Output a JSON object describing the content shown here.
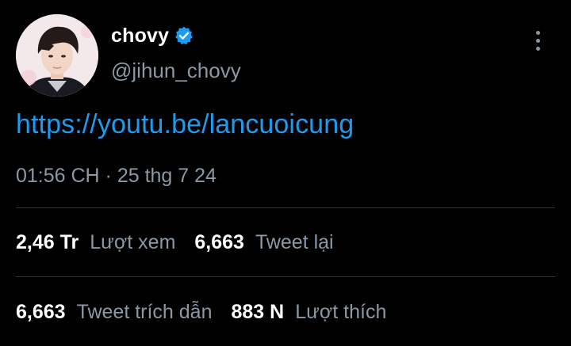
{
  "user": {
    "display_name": "chovy",
    "handle": "@jihun_chovy",
    "verified": true
  },
  "tweet": {
    "link_text": "https://youtu.be/lancuoicung",
    "timestamp": "01:56 CH · 25 thg 7 24"
  },
  "stats": {
    "views_value": "2,46 Tr",
    "views_label": "Lượt xem",
    "retweets_value": "6,663",
    "retweets_label": "Tweet lại",
    "quotes_value": "6,663",
    "quotes_label": "Tweet trích dẫn",
    "likes_value": "883 N",
    "likes_label": "Lượt thích"
  },
  "icons": {
    "verified": "verified-badge-icon",
    "more": "more-vertical-icon"
  },
  "colors": {
    "background": "#000000",
    "link": "#1d9bf0",
    "secondary_text": "#8b98a5",
    "primary_text": "#ffffff",
    "divider": "#2f3336",
    "verified": "#1d9bf0"
  }
}
